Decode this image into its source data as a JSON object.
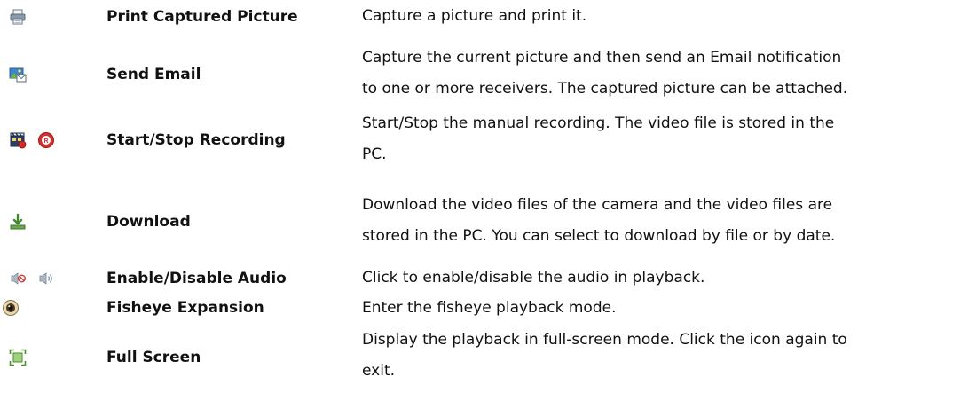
{
  "rows": [
    {
      "name": "Print Captured Picture",
      "description_lines": [
        "Capture a picture and print it."
      ],
      "icons": [
        "printer-icon"
      ]
    },
    {
      "name": "Send Email",
      "description_lines": [
        "Capture the current picture and then send an Email notification",
        "to one or more receivers. The captured picture can be attached."
      ],
      "icons": [
        "email-picture-icon"
      ]
    },
    {
      "name": "Start/Stop Recording",
      "description_lines": [
        "Start/Stop the manual recording. The video file is stored in the",
        "PC."
      ],
      "icons": [
        "recording-clapper-icon",
        "record-button-icon"
      ]
    },
    {
      "name": "Download",
      "description_lines": [
        "Download the video files of the camera and the video files are",
        "stored in the PC. You can select to download by file or by date."
      ],
      "icons": [
        "download-icon"
      ]
    },
    {
      "name": "Enable/Disable Audio",
      "description_lines": [
        "Click to enable/disable the audio in playback."
      ],
      "icons": [
        "audio-disabled-icon",
        "audio-enabled-icon"
      ]
    },
    {
      "name": "Fisheye Expansion",
      "description_lines": [
        "Enter the fisheye playback mode."
      ],
      "icons": [
        "fisheye-icon"
      ]
    },
    {
      "name": "Full Screen",
      "description_lines": [
        "Display the playback in full-screen mode. Click the icon again to",
        "exit."
      ],
      "icons": [
        "fullscreen-icon"
      ]
    }
  ]
}
